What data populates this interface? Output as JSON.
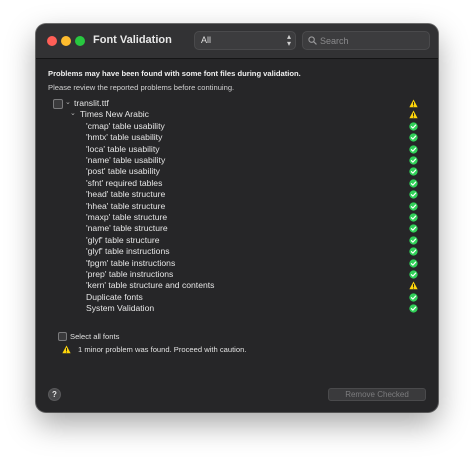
{
  "window": {
    "title": "Font Validation",
    "scope_select": {
      "value": "All"
    },
    "search": {
      "placeholder": "Search",
      "value": ""
    }
  },
  "message": {
    "headline": "Problems may have been found with some font files during validation.",
    "subtext": "Please review the reported problems before continuing."
  },
  "tree": {
    "file": {
      "label": "translit.ttf",
      "status": "warning"
    },
    "font": {
      "label": "Times New Arabic",
      "status": "warning"
    },
    "checks": [
      {
        "label": "'cmap' table usability",
        "status": "pass"
      },
      {
        "label": "'hmtx' table usability",
        "status": "pass"
      },
      {
        "label": "'loca' table usability",
        "status": "pass"
      },
      {
        "label": "'name' table usability",
        "status": "pass"
      },
      {
        "label": "'post' table usability",
        "status": "pass"
      },
      {
        "label": "'sfnt' required tables",
        "status": "pass"
      },
      {
        "label": "'head' table structure",
        "status": "pass"
      },
      {
        "label": "'hhea' table structure",
        "status": "pass"
      },
      {
        "label": "'maxp' table structure",
        "status": "pass"
      },
      {
        "label": "'name' table structure",
        "status": "pass"
      },
      {
        "label": "'glyf' table structure",
        "status": "pass"
      },
      {
        "label": "'glyf' table instructions",
        "status": "pass"
      },
      {
        "label": "'fpgm' table instructions",
        "status": "pass"
      },
      {
        "label": "'prep' table instructions",
        "status": "pass"
      },
      {
        "label": "'kern' table structure and contents",
        "status": "warning"
      },
      {
        "label": "Duplicate fonts",
        "status": "pass"
      },
      {
        "label": "System Validation",
        "status": "pass"
      }
    ]
  },
  "footer": {
    "select_all_label": "Select all fonts",
    "summary": "1 minor problem was found. Proceed with caution.",
    "help_label": "?",
    "remove_button": "Remove Checked"
  },
  "colors": {
    "pass": "#30d158",
    "warning": "#ffd60a"
  }
}
